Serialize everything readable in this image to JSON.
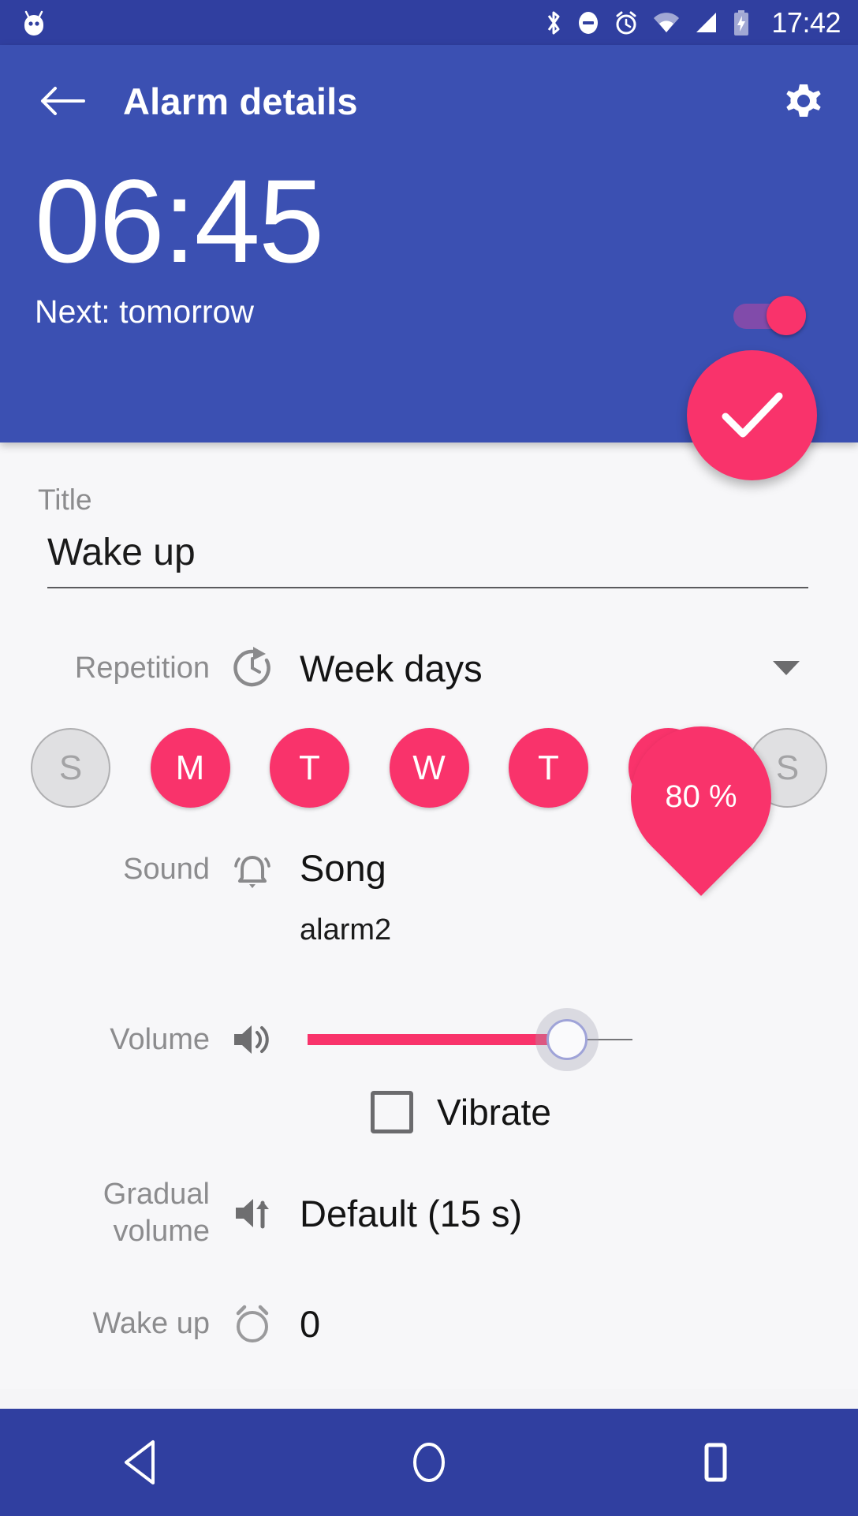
{
  "statusbar": {
    "clock": "17:42",
    "icons": [
      "android-robot-icon",
      "bluetooth-icon",
      "do-not-disturb-icon",
      "alarm-icon",
      "wifi-icon",
      "cellular-signal-icon",
      "battery-charging-icon"
    ]
  },
  "appbar": {
    "back_label": "back-arrow",
    "title": "Alarm details",
    "settings_label": "settings-gear"
  },
  "alarm": {
    "time": "06:45",
    "next": "Next: tomorrow",
    "enabled": true
  },
  "fab": {
    "label": "check-mark",
    "color": "#F9336B"
  },
  "form": {
    "title_label": "Title",
    "title_value": "Wake up",
    "title_placeholder": "Title",
    "repetition": {
      "label": "Repetition",
      "value": "Week days",
      "icon": "repeat-clock-icon"
    },
    "days": [
      {
        "letter": "S",
        "name": "sunday",
        "active": false
      },
      {
        "letter": "M",
        "name": "monday",
        "active": true
      },
      {
        "letter": "T",
        "name": "tuesday",
        "active": true
      },
      {
        "letter": "W",
        "name": "wednesday",
        "active": true
      },
      {
        "letter": "T",
        "name": "thursday",
        "active": true
      },
      {
        "letter": "F",
        "name": "friday",
        "active": true
      },
      {
        "letter": "S",
        "name": "saturday",
        "active": false
      }
    ],
    "sound": {
      "label": "Sound",
      "type": "Song",
      "name": "alarm2",
      "icon": "bell-ringing-icon"
    },
    "volume": {
      "label": "Volume",
      "bubble": "80 %",
      "percent": 80,
      "icon": "speaker-icon"
    },
    "vibrate": {
      "label": "Vibrate",
      "checked": false
    },
    "gradual_volume": {
      "label_line1": "Gradual",
      "label_line2": "volume",
      "value": "Default (15 s)",
      "icon": "speaker-up-icon"
    },
    "wake_up": {
      "label": "Wake up",
      "value": "0",
      "icon": "alarm-clock-icon"
    }
  },
  "navbar": {
    "back": "nav-back-triangle",
    "home": "nav-home-circle",
    "recents": "nav-recents-square"
  },
  "colors": {
    "primary": "#3B50B2",
    "primary_dark": "#303FA0",
    "accent": "#F9336B",
    "background": "#F7F7F9"
  }
}
